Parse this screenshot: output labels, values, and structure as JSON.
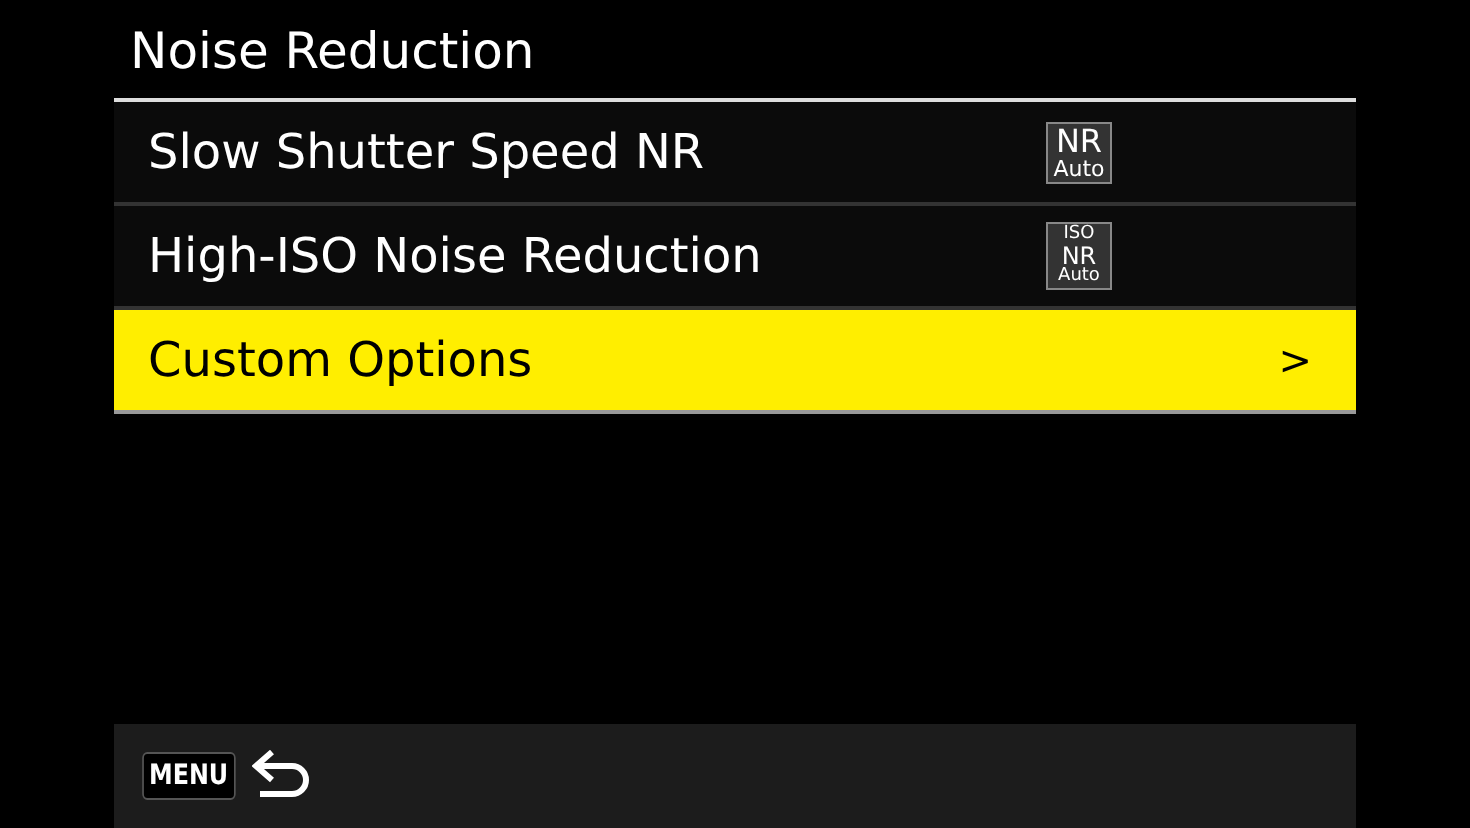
{
  "title": "Noise Reduction",
  "items": [
    {
      "label": "Slow Shutter Speed NR",
      "badge": [
        "NR",
        "Auto"
      ],
      "selected": false
    },
    {
      "label": "High-ISO Noise Reduction",
      "badge": [
        "ISO",
        "NR",
        "Auto"
      ],
      "selected": false
    },
    {
      "label": "Custom Options",
      "chevron": ">",
      "selected": true
    }
  ],
  "footer": {
    "menu_key": "MENU"
  }
}
